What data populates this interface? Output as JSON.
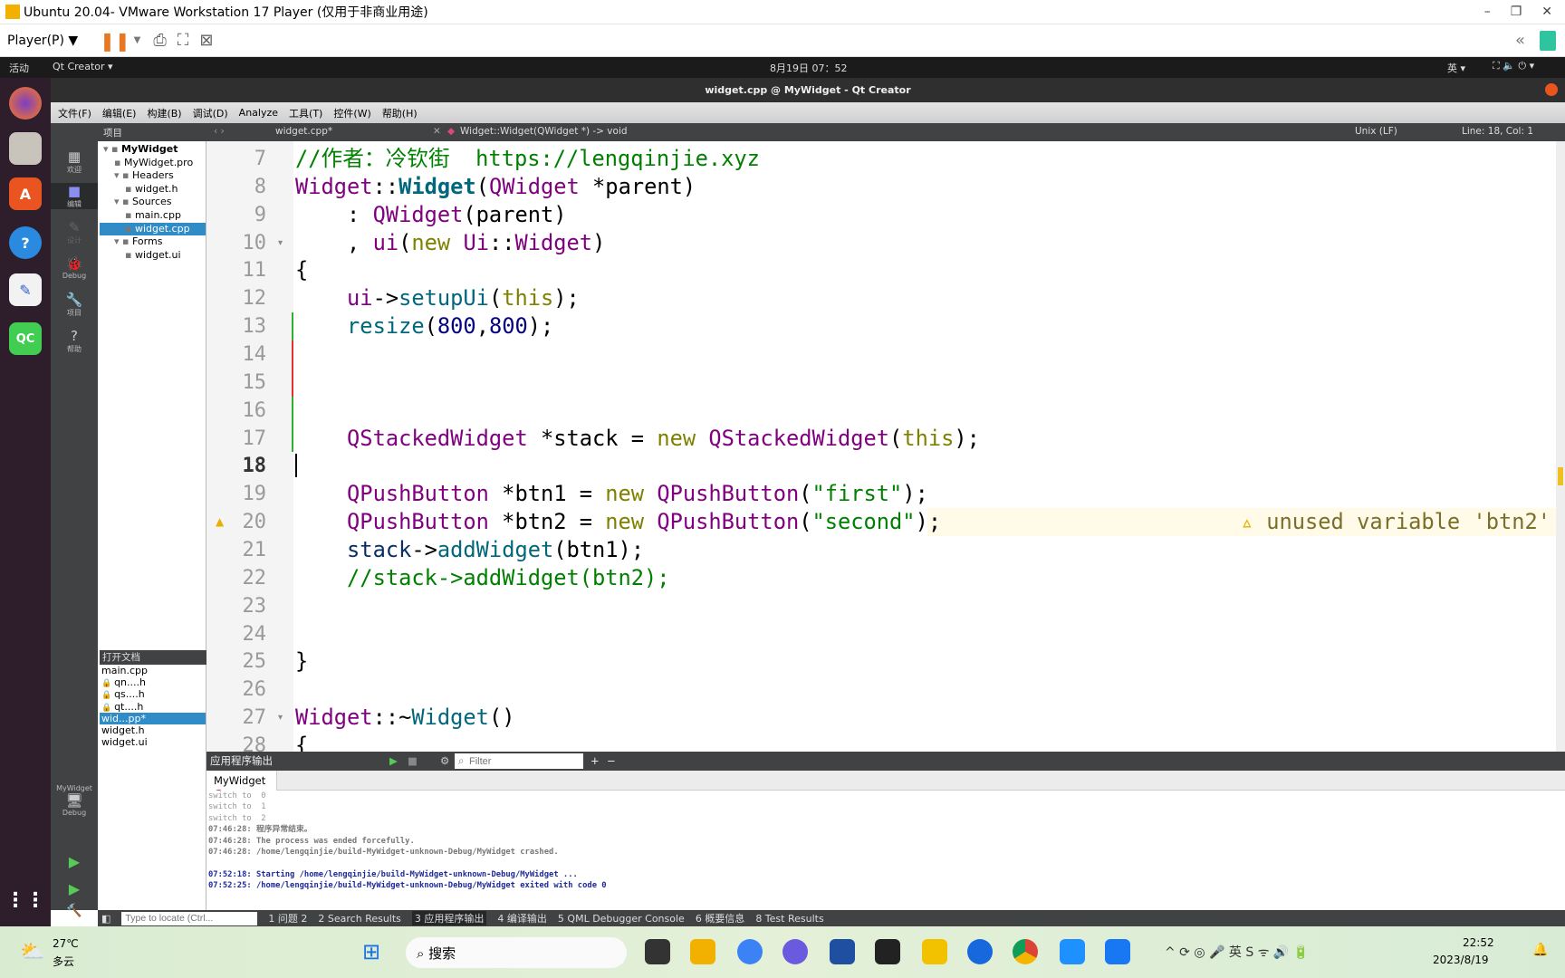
{
  "vmware": {
    "title": "Ubuntu 20.04- VMware Workstation 17 Player (仅用于非商业用途)",
    "player_menu": "Player(P) ▼"
  },
  "ubuntu": {
    "activities": "活动",
    "app_menu": "Qt Creator ▾",
    "clock": "8月19日 07：52",
    "ime": "英 ▾"
  },
  "qt": {
    "window_title": "widget.cpp @ MyWidget - Qt Creator",
    "menu": [
      "文件(F)",
      "编辑(E)",
      "构建(B)",
      "调试(D)",
      "Analyze",
      "工具(T)",
      "控件(W)",
      "帮助(H)"
    ],
    "toolbar": {
      "project_label": "项目",
      "file_tab": "widget.cpp*",
      "function": "Widget::Widget(QWidget *) -> void",
      "line_ending": "Unix (LF)",
      "position": "Line: 18, Col: 1"
    },
    "modes": [
      "欢迎",
      "编辑",
      "设计",
      "Debug",
      "项目",
      "帮助"
    ],
    "kit": {
      "project": "MyWidget",
      "mode": "Debug"
    },
    "tree": [
      {
        "label": "MyWidget",
        "level": 0
      },
      {
        "label": "MyWidget.pro",
        "level": 1
      },
      {
        "label": "Headers",
        "level": 1
      },
      {
        "label": "widget.h",
        "level": 2
      },
      {
        "label": "Sources",
        "level": 1
      },
      {
        "label": "main.cpp",
        "level": 2
      },
      {
        "label": "widget.cpp",
        "level": 2,
        "selected": true
      },
      {
        "label": "Forms",
        "level": 1
      },
      {
        "label": "widget.ui",
        "level": 2
      }
    ],
    "open_docs_title": "打开文档",
    "open_docs": [
      {
        "label": "main.cpp"
      },
      {
        "label": "qn....h",
        "locked": true
      },
      {
        "label": "qs....h",
        "locked": true
      },
      {
        "label": "qt....h",
        "locked": true
      },
      {
        "label": "wid...pp*",
        "selected": true
      },
      {
        "label": "widget.h"
      },
      {
        "label": "widget.ui"
      }
    ],
    "editor": {
      "lines": [
        {
          "n": "7",
          "tokens": [
            [
              "//作者：冷钦街  https://lengqinjie.xyz",
              "c"
            ]
          ]
        },
        {
          "n": "8",
          "tokens": [
            [
              "Widget",
              "t"
            ],
            [
              "::",
              ""
            ],
            [
              "Widget",
              "b"
            ],
            [
              "(",
              ""
            ],
            [
              "QWidget",
              "t"
            ],
            [
              " *parent)",
              ""
            ]
          ]
        },
        {
          "n": "9",
          "tokens": [
            [
              "    : ",
              ""
            ],
            [
              "QWidget",
              "t"
            ],
            [
              "(parent)",
              ""
            ]
          ]
        },
        {
          "n": "10",
          "fold": true,
          "tokens": [
            [
              "    , ",
              ""
            ],
            [
              "ui",
              "t"
            ],
            [
              "(",
              ""
            ],
            [
              "new",
              "k"
            ],
            [
              " ",
              ""
            ],
            [
              "Ui",
              "t"
            ],
            [
              "::",
              ""
            ],
            [
              "Widget",
              "t"
            ],
            [
              ")",
              ""
            ]
          ]
        },
        {
          "n": "11",
          "tokens": [
            [
              "{",
              ""
            ]
          ]
        },
        {
          "n": "12",
          "tokens": [
            [
              "    ",
              ""
            ],
            [
              "ui",
              "t"
            ],
            [
              "->",
              ""
            ],
            [
              "setupUi",
              "f"
            ],
            [
              "(",
              ""
            ],
            [
              "this",
              "k"
            ],
            [
              ");",
              ""
            ]
          ]
        },
        {
          "n": "13",
          "tokens": [
            [
              "    ",
              ""
            ],
            [
              "resize",
              "f"
            ],
            [
              "(",
              ""
            ],
            [
              "800",
              "n"
            ],
            [
              ",",
              ""
            ],
            [
              "800",
              "n"
            ],
            [
              ");",
              ""
            ]
          ]
        },
        {
          "n": "14",
          "tokens": []
        },
        {
          "n": "15",
          "tokens": []
        },
        {
          "n": "16",
          "tokens": []
        },
        {
          "n": "17",
          "tokens": [
            [
              "    ",
              ""
            ],
            [
              "QStackedWidget",
              "t"
            ],
            [
              " *stack = ",
              ""
            ],
            [
              "new",
              "k"
            ],
            [
              " ",
              ""
            ],
            [
              "QStackedWidget",
              "t"
            ],
            [
              "(",
              ""
            ],
            [
              "this",
              "k"
            ],
            [
              ");",
              ""
            ]
          ]
        },
        {
          "n": "18",
          "current": true,
          "tokens": []
        },
        {
          "n": "19",
          "tokens": [
            [
              "    ",
              ""
            ],
            [
              "QPushButton",
              "t"
            ],
            [
              " *btn1 = ",
              ""
            ],
            [
              "new",
              "k"
            ],
            [
              " ",
              ""
            ],
            [
              "QPushButton",
              "t"
            ],
            [
              "(",
              ""
            ],
            [
              "\"first\"",
              "s"
            ],
            [
              ");",
              ""
            ]
          ]
        },
        {
          "n": "20",
          "warning": true,
          "tokens": [
            [
              "    ",
              ""
            ],
            [
              "QPushButton",
              "t"
            ],
            [
              " *btn2 = ",
              ""
            ],
            [
              "new",
              "k"
            ],
            [
              " ",
              ""
            ],
            [
              "QPushButton",
              "t"
            ],
            [
              "(",
              ""
            ],
            [
              "\"second\"",
              "s"
            ],
            [
              ");",
              ""
            ]
          ]
        },
        {
          "n": "21",
          "tokens": [
            [
              "    ",
              ""
            ],
            [
              "stack",
              "p"
            ],
            [
              "->",
              ""
            ],
            [
              "addWidget",
              "f"
            ],
            [
              "(btn1);",
              ""
            ]
          ]
        },
        {
          "n": "22",
          "tokens": [
            [
              "    //stack->addWidget(btn2);",
              "c"
            ]
          ]
        },
        {
          "n": "23",
          "tokens": []
        },
        {
          "n": "24",
          "tokens": []
        },
        {
          "n": "25",
          "tokens": [
            [
              "}",
              ""
            ]
          ]
        },
        {
          "n": "26",
          "tokens": []
        },
        {
          "n": "27",
          "fold": true,
          "tokens": [
            [
              "Widget",
              "t"
            ],
            [
              "::~",
              ""
            ],
            [
              "Widget",
              "f"
            ],
            [
              "()",
              ""
            ]
          ]
        },
        {
          "n": "28",
          "tokens": [
            [
              "{",
              ""
            ]
          ]
        }
      ],
      "warning_text": "unused variable 'btn2'"
    },
    "output": {
      "title": "应用程序输出",
      "filter_placeholder": "Filter",
      "tab": "MyWidget",
      "lines": [
        {
          "text": "switch to  0",
          "style": "gray"
        },
        {
          "text": "switch to  1",
          "style": "gray"
        },
        {
          "text": "switch to  2",
          "style": "gray"
        },
        {
          "text": "07:46:28: 程序异常结束。",
          "style": "dark"
        },
        {
          "text": "07:46:28: The process was ended forcefully.",
          "style": "dark"
        },
        {
          "text": "07:46:28: /home/lengqinjie/build-MyWidget-unknown-Debug/MyWidget crashed.",
          "style": "dark"
        },
        {
          "text": "",
          "style": "dark"
        },
        {
          "text": "07:52:18: Starting /home/lengqinjie/build-MyWidget-unknown-Debug/MyWidget ...",
          "style": "blue"
        },
        {
          "text": "07:52:25: /home/lengqinjie/build-MyWidget-unknown-Debug/MyWidget exited with code 0",
          "style": "blue"
        }
      ]
    },
    "status": {
      "locate_placeholder": "Type to locate (Ctrl...",
      "tabs": [
        "1 问题 2",
        "2 Search Results",
        "3 应用程序输出",
        "4 编译输出",
        "5 QML Debugger Console",
        "6 概要信息",
        "8 Test Results"
      ]
    }
  },
  "taskbar": {
    "weather_temp": "27℃",
    "weather_desc": "多云",
    "search": "搜索",
    "time": "22:52",
    "date": "2023/8/19"
  }
}
